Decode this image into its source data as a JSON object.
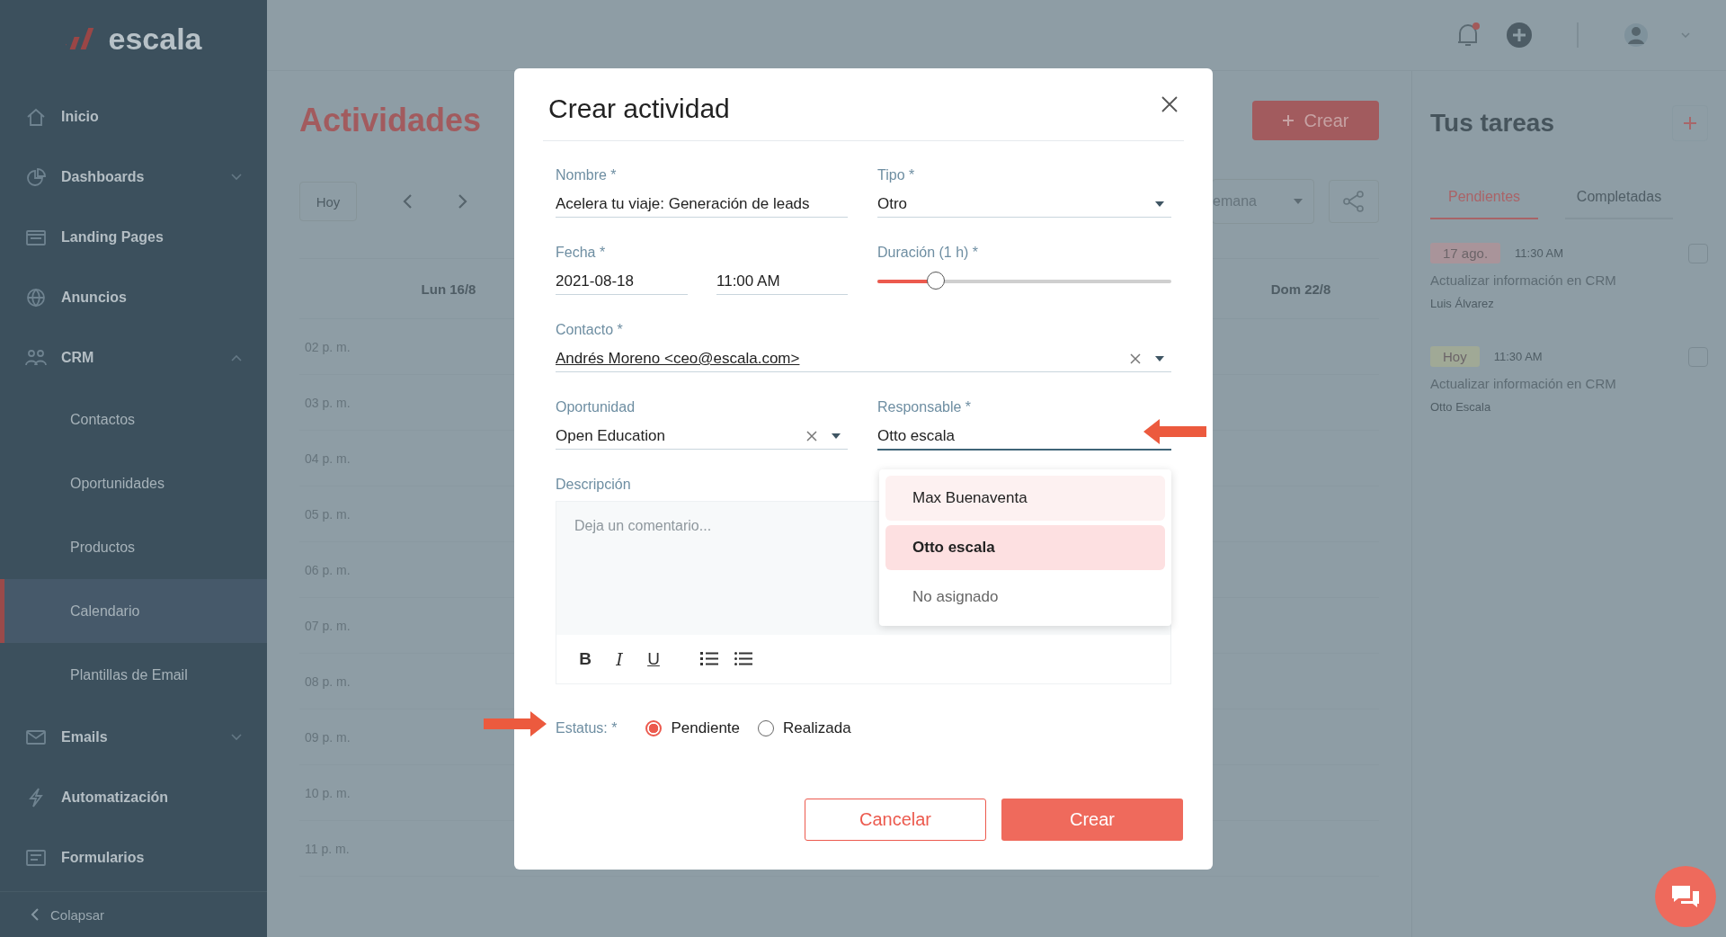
{
  "sidebar": {
    "logo": "escala",
    "items": [
      {
        "label": "Inicio",
        "selected": false
      },
      {
        "label": "Dashboards",
        "selected": false,
        "expanded": false
      },
      {
        "label": "Landing Pages",
        "selected": false
      },
      {
        "label": "Anuncios",
        "selected": false
      },
      {
        "label": "CRM",
        "selected": false,
        "expanded": true,
        "children": [
          {
            "label": "Contactos",
            "selected": false
          },
          {
            "label": "Oportunidades",
            "selected": false
          },
          {
            "label": "Productos",
            "selected": false
          },
          {
            "label": "Calendario",
            "selected": true
          },
          {
            "label": "Plantillas de Email",
            "selected": false
          }
        ]
      },
      {
        "label": "Emails",
        "selected": false,
        "expanded": false
      },
      {
        "label": "Automatización",
        "selected": false
      },
      {
        "label": "Formularios",
        "selected": false
      }
    ],
    "collapse": "Colapsar"
  },
  "header": {
    "title": "Actividades",
    "create_button": "Crear"
  },
  "toolbar": {
    "today_button": "Hoy",
    "view_select": "emana"
  },
  "calendar": {
    "days": [
      "Lun 16/8",
      "Dom 22/8"
    ],
    "times": [
      "02 p. m.",
      "03 p. m.",
      "04 p. m.",
      "05 p. m.",
      "06 p. m.",
      "07 p. m.",
      "08 p. m.",
      "09 p. m.",
      "10 p. m.",
      "11 p. m."
    ]
  },
  "tasks_panel": {
    "title": "Tus tareas",
    "tabs": [
      {
        "label": "Pendientes",
        "selected": true
      },
      {
        "label": "Completadas",
        "selected": false
      }
    ],
    "tasks": [
      {
        "badge": "17 ago.",
        "color": "#a9949a",
        "time": "11:30 AM",
        "title": "Actualizar información en CRM",
        "owner": "Luis Álvarez",
        "checked": false
      },
      {
        "badge": "Hoy",
        "color": "#a0a996",
        "time": "11:30 AM",
        "title": "Actualizar información en CRM",
        "owner": "Otto Escala",
        "checked": false
      }
    ]
  },
  "modal": {
    "title": "Crear actividad",
    "nombre": {
      "label": "Nombre *",
      "value": "Acelera tu viaje: Generación de leads"
    },
    "tipo": {
      "label": "Tipo *",
      "value": "Otro"
    },
    "fecha": {
      "label": "Fecha *",
      "date": "2021-08-18",
      "time": "11:00 AM"
    },
    "duracion": {
      "label": "Duración (1 h) *",
      "level": 0.2
    },
    "contacto": {
      "label": "Contacto *",
      "value": "Andrés Moreno <ceo@escala.com>"
    },
    "oportunidad": {
      "label": "Oportunidad",
      "value": "Open Education"
    },
    "responsable": {
      "label": "Responsable *",
      "value": "Otto escala",
      "expanded": true,
      "options": [
        {
          "label": "Max Buenaventa",
          "selected": false,
          "highlighted": true
        },
        {
          "label": "Otto escala",
          "selected": true,
          "highlighted": false
        },
        {
          "label": "No asignado",
          "selected": false,
          "highlighted": false
        }
      ]
    },
    "descripcion": {
      "label": "Descripción",
      "placeholder": "Deja un comentario...",
      "toolbar": [
        {
          "kind": "bold",
          "label": "B"
        },
        {
          "kind": "italic",
          "label": "I"
        },
        {
          "kind": "underline",
          "label": "U"
        },
        {
          "kind": "ordered-list"
        },
        {
          "kind": "bullet-list"
        }
      ]
    },
    "estatus": {
      "label": "Estatus: *",
      "options": [
        {
          "label": "Pendiente",
          "selected": true
        },
        {
          "label": "Realizada",
          "selected": false
        }
      ]
    },
    "buttons": [
      {
        "kind": "secondary",
        "label": "Cancelar"
      },
      {
        "kind": "primary",
        "label": "Crear"
      }
    ]
  }
}
